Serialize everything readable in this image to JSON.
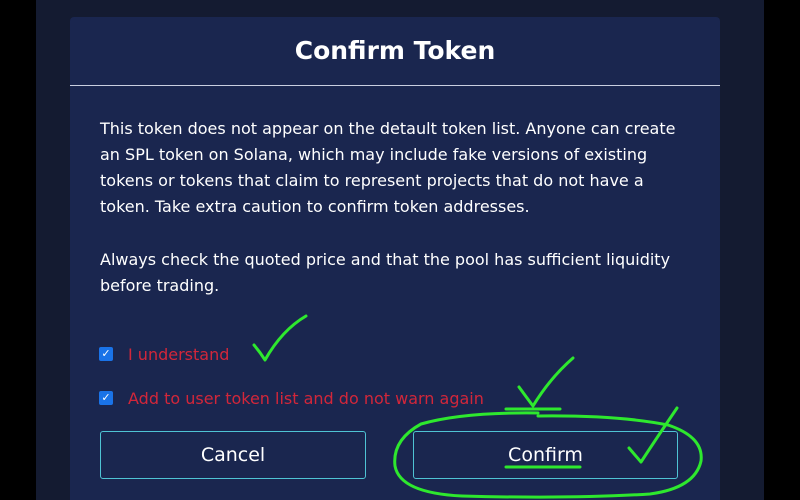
{
  "modal": {
    "title": "Confirm Token",
    "paragraph1": "This token does not appear on the detault token list. Anyone can create an SPL token on Solana, which may include fake versions of existing tokens or tokens that claim to represent projects that do not have a token. Take extra caution to confirm token addresses.",
    "paragraph2": "Always check the quoted price and that the pool has sufficient liquidity before trading."
  },
  "checkboxes": [
    {
      "label": "I understand",
      "checked": true
    },
    {
      "label": "Add to user token list and do not warn again",
      "checked": true
    }
  ],
  "buttons": {
    "cancel": "Cancel",
    "confirm": "Confirm"
  },
  "colors": {
    "modal_bg": "#1a264f",
    "backdrop": "#141b31",
    "button_border": "#4fc3d4",
    "warning_text": "#d2263a",
    "checkbox": "#1a73e8",
    "annotation": "#2ee82e"
  },
  "icons": {
    "checkbox_mark": "✓"
  }
}
